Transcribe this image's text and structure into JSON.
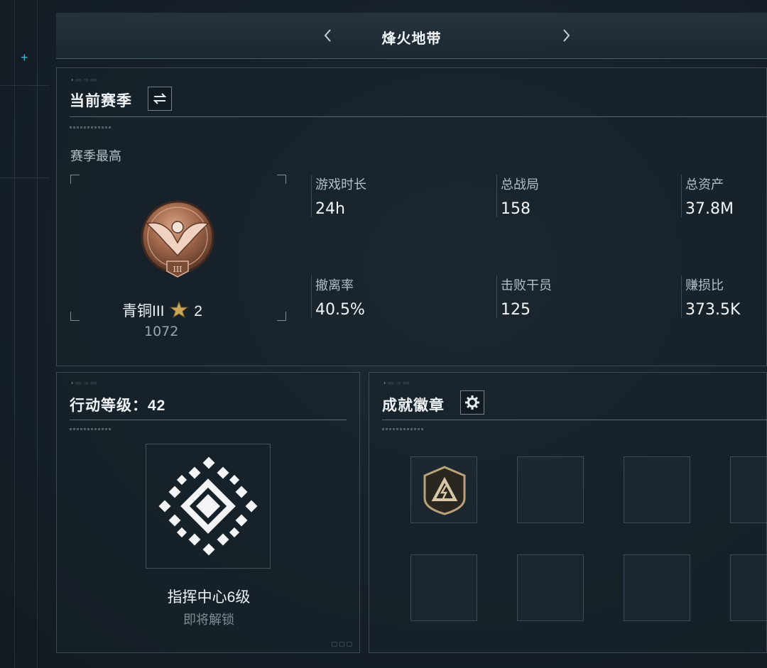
{
  "header": {
    "title": "烽火地带"
  },
  "season": {
    "title": "当前赛季",
    "subtitle": "赛季最高",
    "rank_name": "青铜III",
    "rank_stars": "2",
    "rank_score": "1072",
    "stats": [
      {
        "label": "游戏时长",
        "value": "24h"
      },
      {
        "label": "总战局",
        "value": "158"
      },
      {
        "label": "总资产",
        "value": "37.8M"
      },
      {
        "label": "撤离率",
        "value": "40.5%"
      },
      {
        "label": "击败干员",
        "value": "125"
      },
      {
        "label": "赚损比",
        "value": "373.5K"
      }
    ]
  },
  "action_level": {
    "title": "行动等级：42",
    "unlock_name": "指挥中心6级",
    "unlock_status": "即将解锁"
  },
  "achievements": {
    "title": "成就徽章"
  },
  "icons": [
    "chevron-left-icon",
    "chevron-right-icon",
    "swap-icon",
    "gear-icon",
    "bronze-eagle-rank-icon",
    "star-icon",
    "command-center-icon",
    "achievement-badge-icon"
  ],
  "colors": {
    "accent_cyan": "#3fb7c9",
    "bronze": "#b07a5a",
    "gold_star": "#c9a75a"
  }
}
